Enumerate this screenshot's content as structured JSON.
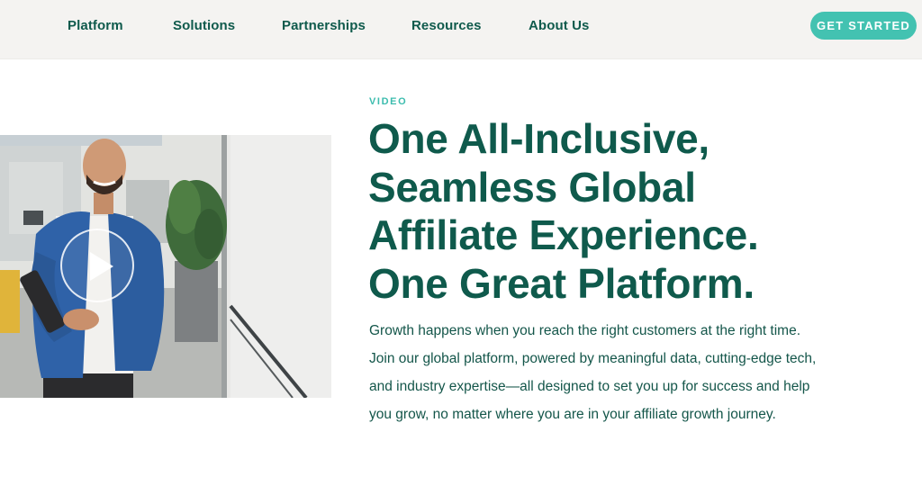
{
  "nav": {
    "items": [
      {
        "label": "Platform"
      },
      {
        "label": "Solutions"
      },
      {
        "label": "Partnerships"
      },
      {
        "label": "Resources"
      },
      {
        "label": "About Us"
      }
    ],
    "cta_label": "GET STARTED"
  },
  "hero": {
    "eyebrow": "VIDEO",
    "headline_lines": [
      "One All-Inclusive,",
      "Seamless Global",
      "Affiliate Experience.",
      "One Great Platform."
    ],
    "body_lines": [
      "Growth happens when you reach the right customers at the right time.",
      "Join our global platform, powered by meaningful data, cutting-edge tech,",
      "and industry expertise—all designed to set you up for success and help",
      "you grow, no matter where you are in your affiliate growth journey."
    ]
  },
  "video": {
    "thumbnail_icon": "person-photo",
    "play_icon": "play-icon"
  },
  "colors": {
    "nav_bg": "#f4f3f1",
    "brand_green": "#0f5a4c",
    "accent_teal": "#43c2b1"
  }
}
